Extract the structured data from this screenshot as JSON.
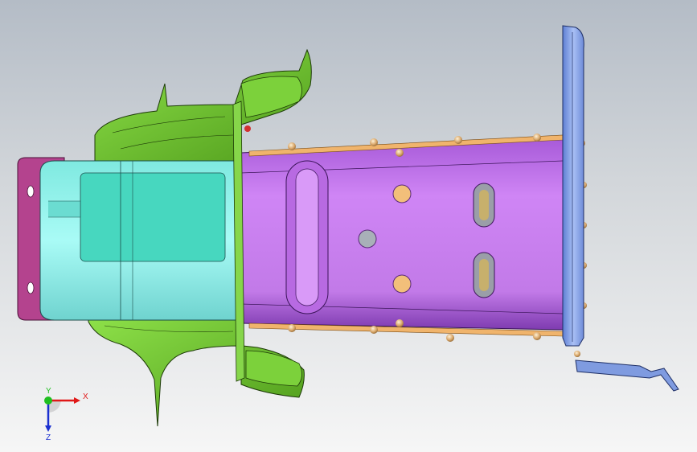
{
  "viewport": {
    "background_top": "#b4bcc6",
    "background_bottom": "#f6f6f6"
  },
  "model": {
    "parts": [
      {
        "name": "mounting-plate",
        "color": "#7f9be0"
      },
      {
        "name": "main-rail",
        "color": "#c97cf0"
      },
      {
        "name": "inner-box",
        "color": "#8ff0ea"
      },
      {
        "name": "end-cap",
        "color": "#b4438e"
      },
      {
        "name": "green-bracket",
        "color": "#66b926"
      },
      {
        "name": "flange-edge",
        "color": "#f0b46c"
      },
      {
        "name": "weld-spot",
        "color": "#d9a76a"
      }
    ]
  },
  "triad": {
    "x_label": "X",
    "y_label": "Y",
    "z_label": "Z",
    "x_color": "#e01818",
    "y_color": "#1fbf1f",
    "z_color": "#1a2fd0"
  }
}
